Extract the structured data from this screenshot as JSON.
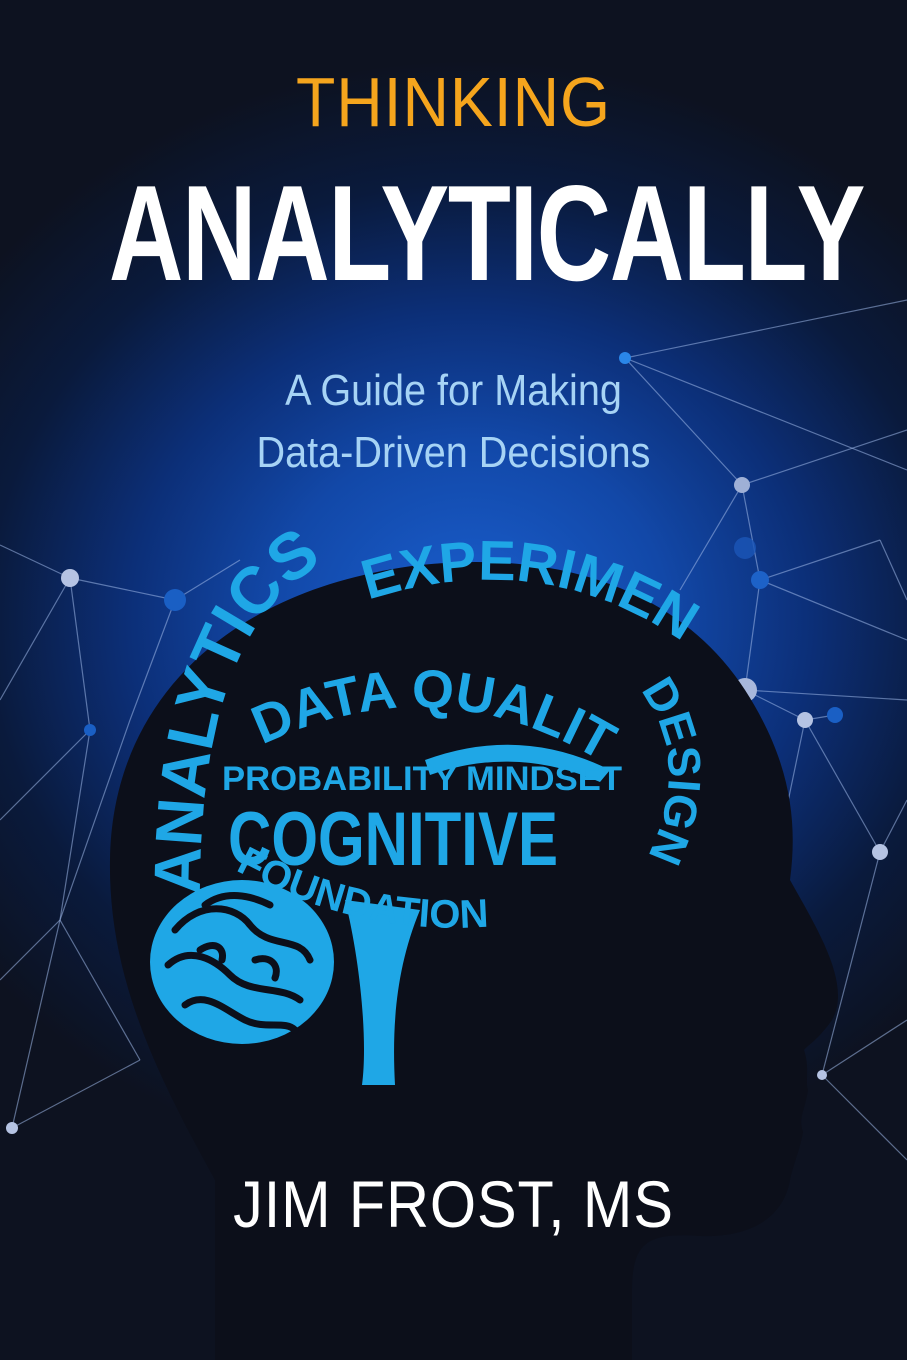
{
  "cover": {
    "title_line1": "THINKING",
    "title_line2": "ANALYTICALLY",
    "subtitle_line1": "A Guide for Making",
    "subtitle_line2": "Data-Driven Decisions",
    "author": "JIM FROST, MS"
  },
  "brain_words": {
    "analytics": "ANALYTICS",
    "experimental": "EXPERIMENTAL",
    "design": "DESIGN",
    "data_quality": "DATA QUALITY",
    "probability_mindset": "PROBABILITY MINDSET",
    "cognitive": "COGNITIVE",
    "foundation": "FOUNDATION"
  },
  "colors": {
    "title_accent": "#f5a51d",
    "title_main": "#ffffff",
    "subtitle": "#a6d3f5",
    "brain_text": "#1fa7e6",
    "head_silhouette": "#0c0f1a",
    "network": "#9fb8e8"
  },
  "icons": {
    "head": "head-silhouette-icon",
    "cerebellum": "cerebellum-icon",
    "network": "network-graph-icon"
  }
}
